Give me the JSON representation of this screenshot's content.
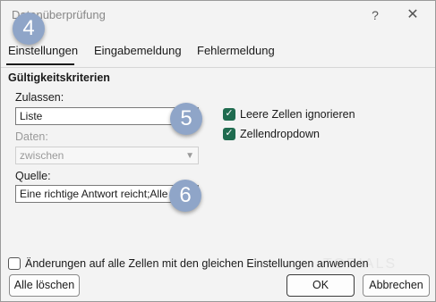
{
  "window": {
    "title": "Datenüberprüfung",
    "help_glyph": "?",
    "close_glyph": "✕"
  },
  "badges": {
    "tabs": "4",
    "allow": "5",
    "source": "6"
  },
  "tabs": [
    {
      "label": "Einstellungen",
      "active": true
    },
    {
      "label": "Eingabemeldung",
      "active": false
    },
    {
      "label": "Fehlermeldung",
      "active": false
    }
  ],
  "criteria": {
    "group_title": "Gültigkeitskriterien",
    "allow_label": "Zulassen:",
    "allow_value": "Liste",
    "data_label": "Daten:",
    "data_value": "zwischen",
    "source_label": "Quelle:",
    "source_value": "Eine richtige Antwort reicht;Alle A",
    "ignore_blank": {
      "label": "Leere Zellen ignorieren",
      "checked": true
    },
    "in_cell_dropdown": {
      "label": "Zellendropdown",
      "checked": true
    }
  },
  "apply_all": {
    "label": "Änderungen auf alle Zellen mit den gleichen Einstellungen anwenden",
    "checked": false
  },
  "watermark": "TORIALS",
  "buttons": {
    "clear_all": "Alle löschen",
    "ok": "OK",
    "cancel": "Abbrechen"
  },
  "colors": {
    "checkbox_checked": "#1f6b4f",
    "badge": "#8fa5c8"
  }
}
